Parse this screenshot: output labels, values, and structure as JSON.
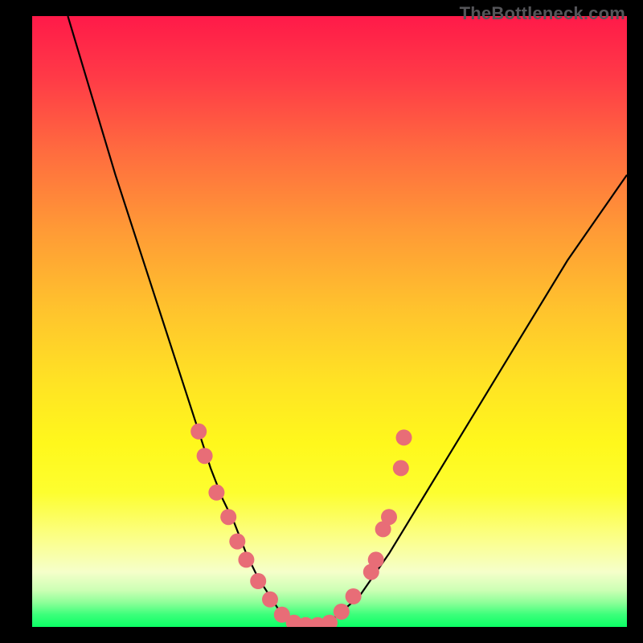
{
  "attribution": "TheBottleneck.com",
  "chart_data": {
    "type": "line",
    "title": "",
    "xlabel": "",
    "ylabel": "",
    "xlim": [
      0,
      100
    ],
    "ylim": [
      0,
      100
    ],
    "series": [
      {
        "name": "curve",
        "x": [
          6,
          10,
          14,
          18,
          22,
          26,
          28,
          30,
          32,
          34,
          36,
          38,
          40,
          42,
          44,
          46,
          48,
          50,
          55,
          60,
          65,
          70,
          75,
          80,
          85,
          90,
          95,
          100
        ],
        "y": [
          100,
          87,
          74,
          62,
          50,
          38,
          32,
          26,
          21,
          17,
          12,
          8,
          5,
          2,
          0.8,
          0.3,
          0.3,
          0.8,
          5,
          12,
          20,
          28,
          36,
          44,
          52,
          60,
          67,
          74
        ]
      }
    ],
    "markers": {
      "color": "#e86d77",
      "radius_px": 10,
      "points": [
        {
          "x": 28,
          "y": 32
        },
        {
          "x": 29,
          "y": 28
        },
        {
          "x": 31,
          "y": 22
        },
        {
          "x": 33,
          "y": 18
        },
        {
          "x": 34.5,
          "y": 14
        },
        {
          "x": 36,
          "y": 11
        },
        {
          "x": 38,
          "y": 7.5
        },
        {
          "x": 40,
          "y": 4.5
        },
        {
          "x": 42,
          "y": 2
        },
        {
          "x": 44,
          "y": 0.7
        },
        {
          "x": 46,
          "y": 0.3
        },
        {
          "x": 48,
          "y": 0.3
        },
        {
          "x": 50,
          "y": 0.7
        },
        {
          "x": 52,
          "y": 2.5
        },
        {
          "x": 54,
          "y": 5
        },
        {
          "x": 57,
          "y": 9
        },
        {
          "x": 57.8,
          "y": 11
        },
        {
          "x": 59,
          "y": 16
        },
        {
          "x": 60,
          "y": 18
        },
        {
          "x": 62,
          "y": 26
        },
        {
          "x": 62.5,
          "y": 31
        }
      ]
    },
    "gradient_bands": [
      {
        "stop": 0.0,
        "color": "#ff1a49"
      },
      {
        "stop": 0.5,
        "color": "#ffd628"
      },
      {
        "stop": 0.92,
        "color": "#f7ffba"
      },
      {
        "stop": 1.0,
        "color": "#0bff65"
      }
    ]
  }
}
